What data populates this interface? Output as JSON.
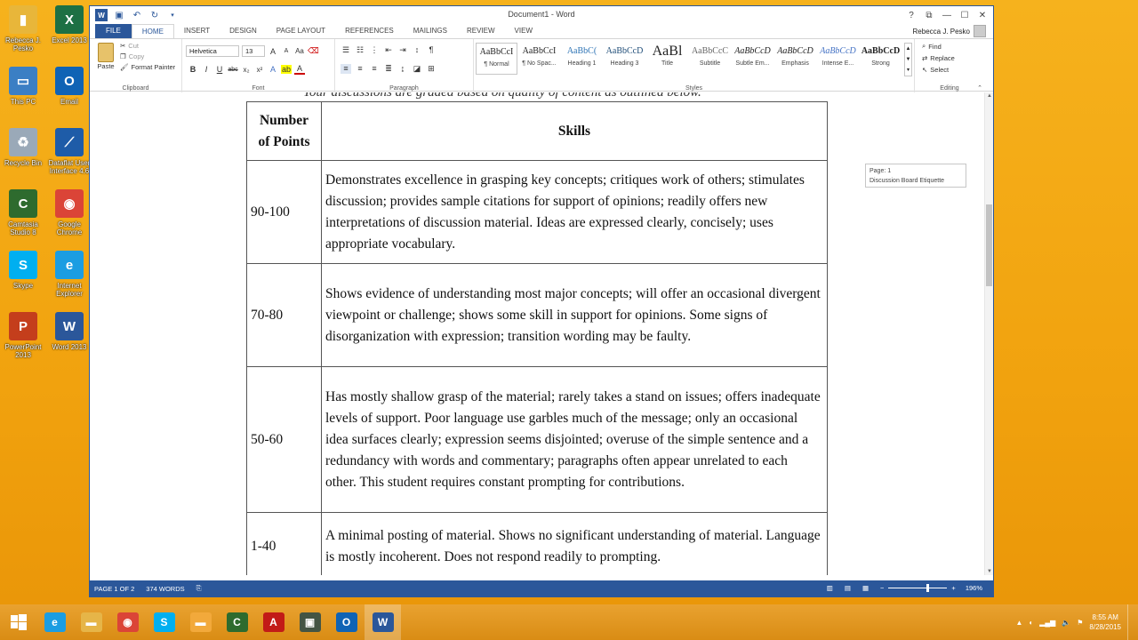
{
  "desktop": {
    "icons": [
      {
        "label": "Rebecca J.\nPesko",
        "icon": "user-folder-icon",
        "color": "#e8b63a",
        "glyph": "▮"
      },
      {
        "label": "Excel 2013",
        "icon": "excel-icon",
        "color": "#1d7044",
        "glyph": "X"
      },
      {
        "label": "This PC",
        "icon": "computer-icon",
        "color": "#3b7fc4",
        "glyph": "▭"
      },
      {
        "label": "Email",
        "icon": "outlook-icon",
        "color": "#0f63b5",
        "glyph": "O"
      },
      {
        "label": "Recycle Bin",
        "icon": "recycle-bin-icon",
        "color": "#9aa9b8",
        "glyph": "♻"
      },
      {
        "label": "Dataflat User\nInterface 4.6",
        "icon": "dataflat-icon",
        "color": "#1e5ca8",
        "glyph": "⟋"
      },
      {
        "label": "Camtasia\nStudio 8",
        "icon": "camtasia-icon",
        "color": "#2e6b2e",
        "glyph": "C"
      },
      {
        "label": "Google\nChrome",
        "icon": "chrome-icon",
        "color": "#db4437",
        "glyph": "◉"
      },
      {
        "label": "Skype",
        "icon": "skype-icon",
        "color": "#00aff0",
        "glyph": "S"
      },
      {
        "label": "Internet\nExplorer",
        "icon": "internet-explorer-icon",
        "color": "#1b9de2",
        "glyph": "e"
      },
      {
        "label": "PowerPoint\n2013",
        "icon": "powerpoint-icon",
        "color": "#c43e1c",
        "glyph": "P"
      },
      {
        "label": "Word 2013",
        "icon": "word-icon",
        "color": "#2b579a",
        "glyph": "W"
      }
    ]
  },
  "window": {
    "title": "Document1 - Word",
    "help": "?",
    "restore_ribbon": "⧉",
    "minimize": "—",
    "maximize": "☐",
    "close": "✕",
    "user_name": "Rebecca J. Pesko"
  },
  "tabs": [
    "FILE",
    "HOME",
    "INSERT",
    "DESIGN",
    "PAGE LAYOUT",
    "REFERENCES",
    "MAILINGS",
    "REVIEW",
    "VIEW"
  ],
  "ribbon": {
    "clipboard": {
      "paste": "Paste",
      "cut": "Cut",
      "copy": "Copy",
      "format_painter": "Format Painter",
      "label": "Clipboard"
    },
    "font": {
      "family": "Helvetica",
      "size": "13",
      "label": "Font"
    },
    "paragraph": {
      "label": "Paragraph"
    },
    "styles": {
      "label": "Styles",
      "items": [
        {
          "preview": "AaBbCcI",
          "name": "¶ Normal"
        },
        {
          "preview": "AaBbCcI",
          "name": "¶ No Spac..."
        },
        {
          "preview": "AaBbC(",
          "name": "Heading 1"
        },
        {
          "preview": "AaBbCcD",
          "name": "Heading 3"
        },
        {
          "preview": "AaBl",
          "name": "Title"
        },
        {
          "preview": "AaBbCcC",
          "name": "Subtitle"
        },
        {
          "preview": "AaBbCcD",
          "name": "Subtle Em..."
        },
        {
          "preview": "AaBbCcD",
          "name": "Emphasis"
        },
        {
          "preview": "AaBbCcD",
          "name": "Intense E..."
        },
        {
          "preview": "AaBbCcD",
          "name": "Strong"
        }
      ]
    },
    "editing": {
      "find": "Find",
      "replace": "Replace",
      "select": "Select",
      "label": "Editing"
    }
  },
  "document": {
    "partial_line": "Your discussions are graded based on quality of content as outlined below.",
    "table": {
      "headers": [
        "Number\nof Points",
        "Skills"
      ],
      "rows": [
        {
          "points": "90-100",
          "skills": " Demonstrates excellence in grasping key concepts; critiques work of others; stimulates discussion; provides sample citations for support of opinions; readily offers new interpretations of discussion material. Ideas are expressed clearly, concisely; uses appropriate vocabulary."
        },
        {
          "points": "70-80",
          "skills": " Shows evidence of understanding most major concepts; will offer an occasional divergent viewpoint or challenge; shows some skill in support for opinions. Some signs of disorganization with expression; transition wording may be faulty."
        },
        {
          "points": "50-60",
          "skills": "Has mostly shallow grasp of the material; rarely takes a stand on issues; offers inadequate levels of support. Poor language use garbles much of the message; only an occasional idea surfaces clearly; expression seems disjointed; overuse of the simple sentence and a redundancy with words and commentary; paragraphs often appear unrelated to each other. This student requires constant prompting for contributions."
        },
        {
          "points": "1-40",
          "skills": " A minimal posting of material. Shows no significant understanding of material. Language is mostly incoherent. Does not respond readily to prompting."
        }
      ]
    }
  },
  "tooltip": {
    "line1": "Page: 1",
    "line2": "Discussion Board Etiquette"
  },
  "status": {
    "page": "PAGE 1 OF 2",
    "words": "374 WORDS",
    "zoom": "196%",
    "zoom_fraction": 0.68
  },
  "taskbar": {
    "apps": [
      {
        "icon": "internet-explorer-icon",
        "color": "#1b9de2",
        "glyph": "e"
      },
      {
        "icon": "file-explorer-icon",
        "color": "#e6b548",
        "glyph": "▬"
      },
      {
        "icon": "chrome-icon",
        "color": "#db4437",
        "glyph": "◉"
      },
      {
        "icon": "skype-icon",
        "color": "#00aff0",
        "glyph": "S"
      },
      {
        "icon": "folder-icon",
        "color": "#f2a93b",
        "glyph": "▬"
      },
      {
        "icon": "camtasia-icon",
        "color": "#2e6b2e",
        "glyph": "C"
      },
      {
        "icon": "acrobat-icon",
        "color": "#c21b17",
        "glyph": "A"
      },
      {
        "icon": "camtasia-recorder-icon",
        "color": "#445544",
        "glyph": "▣"
      },
      {
        "icon": "outlook-icon",
        "color": "#0f63b5",
        "glyph": "O"
      },
      {
        "icon": "word-icon",
        "color": "#2b579a",
        "glyph": "W"
      }
    ],
    "time": "8:55 AM",
    "date": "8/28/2015"
  }
}
